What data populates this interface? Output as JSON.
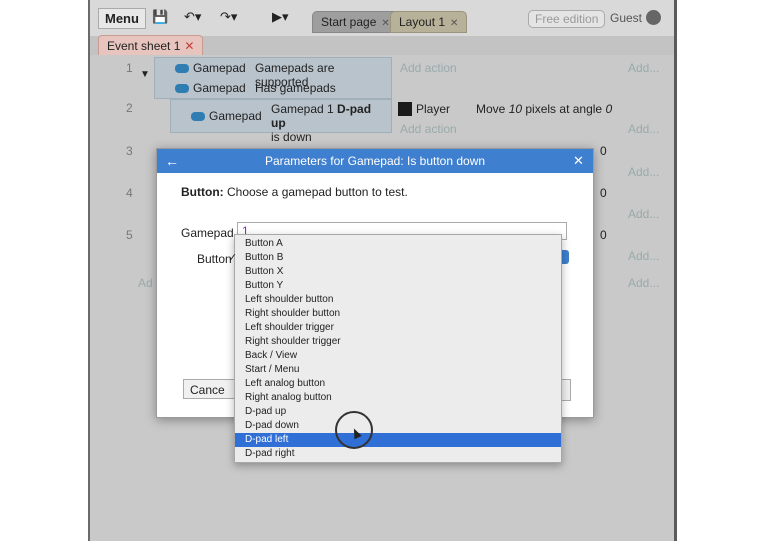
{
  "toolbar": {
    "menu_label": "Menu",
    "tabs": [
      {
        "label": "Start page"
      },
      {
        "label": "Layout 1"
      }
    ],
    "edition_label": "Free edition",
    "user_label": "Guest"
  },
  "sheet_tab": {
    "label": "Event sheet 1"
  },
  "events": {
    "numbers": [
      "1",
      "2",
      "3",
      "4",
      "5"
    ],
    "e1": {
      "cond1_object": "Gamepad",
      "cond1_text": "Gamepads are supported",
      "cond2_object": "Gamepad",
      "cond2_text": "Has gamepads",
      "add_action": "Add action",
      "add_more": "Add..."
    },
    "e2": {
      "object": "Gamepad",
      "cond_text_prefix": "Gamepad 1 ",
      "cond_text_bold": "D-pad up",
      "cond_text_suffix": "is down",
      "action_object": "Player",
      "action_text_prefix": "Move ",
      "action_number": "10",
      "action_text_mid": " pixels at angle ",
      "action_angle": "0",
      "add_action": "Add action",
      "add_more": "Add..."
    },
    "side_values": [
      "0",
      "0",
      "0"
    ],
    "add_more": "Add...",
    "add_left": "Ad"
  },
  "dialog": {
    "title": "Parameters for Gamepad: Is button down",
    "desc_bold": "Button:",
    "desc_text": " Choose a gamepad button to test.",
    "gamepad_label": "Gamepad",
    "gamepad_value": "1",
    "button_label": "Button",
    "cancel_label": "Cance"
  },
  "dropdown": {
    "options": [
      "Button A",
      "Button B",
      "Button X",
      "Button Y",
      "Left shoulder button",
      "Right shoulder button",
      "Left shoulder trigger",
      "Right shoulder trigger",
      "Back / View",
      "Start / Menu",
      "Left analog button",
      "Right analog button",
      "D-pad up",
      "D-pad down",
      "D-pad left",
      "D-pad right"
    ],
    "checked_index": 1,
    "highlighted_index": 14
  },
  "colors": {
    "accent": "#3f7fcf",
    "selection": "#2f6fd6"
  }
}
